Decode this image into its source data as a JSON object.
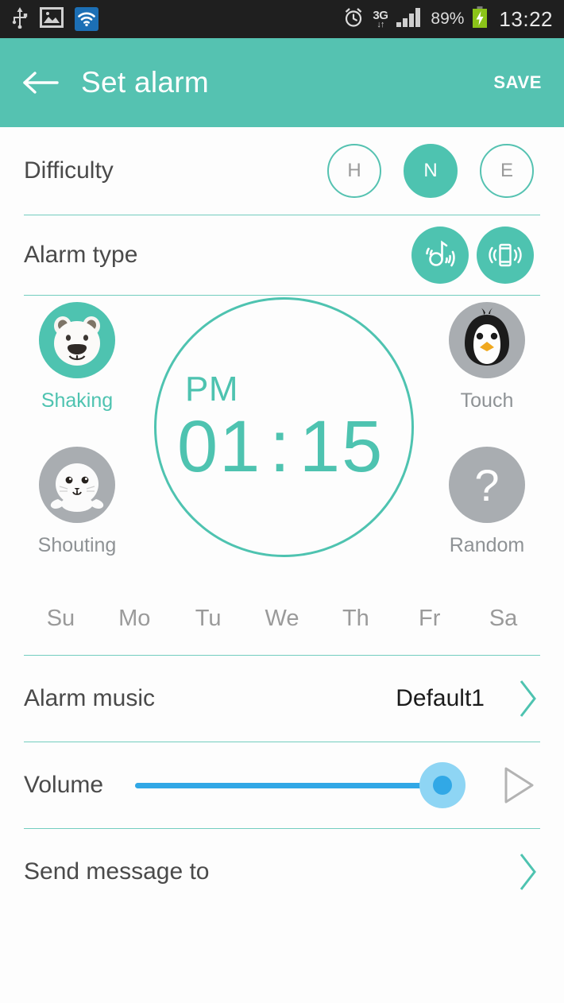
{
  "statusbar": {
    "left_icons": [
      "usb-icon",
      "gallery-icon",
      "wifi-icon"
    ],
    "alarm_icon": "alarm-clock-icon",
    "network_label": "3G",
    "network_arrows": "↓↑",
    "signal_icon": "signal-bars-icon",
    "battery_percent": "89%",
    "battery_icon": "battery-charging-icon",
    "clock": "13:22"
  },
  "appbar": {
    "back_icon": "back-arrow-icon",
    "title": "Set alarm",
    "save_label": "SAVE"
  },
  "difficulty": {
    "label": "Difficulty",
    "options": [
      {
        "label": "H",
        "selected": false
      },
      {
        "label": "N",
        "selected": true
      },
      {
        "label": "E",
        "selected": false
      }
    ]
  },
  "alarm_type": {
    "label": "Alarm type",
    "options": [
      {
        "icon": "music-note-icon",
        "selected": true
      },
      {
        "icon": "vibrate-phone-icon",
        "selected": true
      }
    ]
  },
  "missions": {
    "shaking": {
      "label": "Shaking",
      "icon": "polar-bear-icon",
      "active": true
    },
    "shouting": {
      "label": "Shouting",
      "icon": "seal-icon",
      "active": false
    },
    "touch": {
      "label": "Touch",
      "icon": "penguin-icon",
      "active": false
    },
    "random": {
      "label": "Random",
      "icon": "question-mark-icon",
      "active": false
    }
  },
  "clock": {
    "ampm": "PM",
    "hour": "01",
    "separator": ":",
    "minute": "15"
  },
  "days": [
    {
      "label": "Su",
      "selected": false
    },
    {
      "label": "Mo",
      "selected": false
    },
    {
      "label": "Tu",
      "selected": false
    },
    {
      "label": "We",
      "selected": false
    },
    {
      "label": "Th",
      "selected": false
    },
    {
      "label": "Fr",
      "selected": false
    },
    {
      "label": "Sa",
      "selected": false
    }
  ],
  "alarm_music": {
    "label": "Alarm music",
    "value": "Default1",
    "chevron_icon": "chevron-right-icon"
  },
  "volume": {
    "label": "Volume",
    "value": 95,
    "preview_icon": "play-icon"
  },
  "send_message": {
    "label": "Send message to",
    "chevron_icon": "chevron-right-icon"
  },
  "colors": {
    "accent_teal": "#4ec3b0",
    "appbar_teal": "#55c2b1",
    "slider_blue": "#31a8e6",
    "slider_halo": "#8ed5f4",
    "inactive_gray": "#a9adb1",
    "statusbar_bg": "#1f1f1f"
  }
}
